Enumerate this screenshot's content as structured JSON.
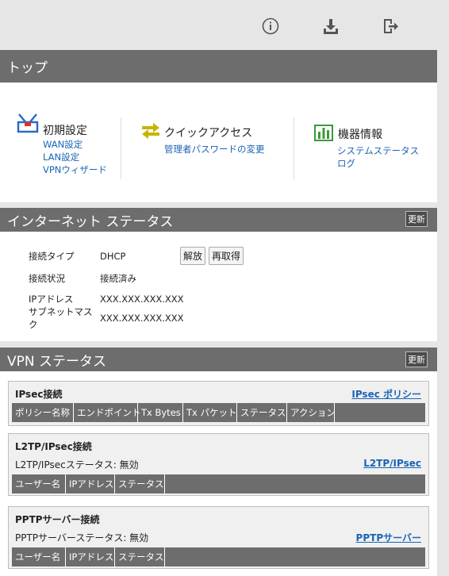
{
  "toolbar": {
    "icons": [
      "info-icon",
      "download-icon",
      "logout-icon"
    ]
  },
  "top": {
    "title": "トップ",
    "menus": [
      {
        "title": "初期設定",
        "icon": "toolbox-icon",
        "links": [
          "WAN設定",
          "LAN設定",
          "VPNウィザード"
        ]
      },
      {
        "title": "クイックアクセス",
        "icon": "swap-arrows-icon",
        "links": [
          "管理者パスワードの変更"
        ]
      },
      {
        "title": "機器情報",
        "icon": "bar-chart-icon",
        "links": [
          "システムステータス",
          "ログ"
        ]
      }
    ]
  },
  "internet": {
    "title": "インターネット ステータス",
    "refresh": "更新",
    "rows": [
      {
        "label": "接続タイプ",
        "value": "DHCP"
      },
      {
        "label": "接続状況",
        "value": "接続済み"
      },
      {
        "label": "IPアドレス",
        "value": "XXX.XXX.XXX.XXX"
      },
      {
        "label": "サブネットマスク",
        "value": "XXX.XXX.XXX.XXX"
      }
    ],
    "release_label": "解放",
    "renew_label": "再取得"
  },
  "vpn": {
    "title": "VPN ステータス",
    "refresh": "更新",
    "ipsec": {
      "title": "IPsec接続",
      "link": "IPsec ポリシー",
      "columns": [
        "ポリシー名称",
        "エンドポイント",
        "Tx Bytes",
        "Tx パケット",
        "ステータス",
        "アクション"
      ]
    },
    "l2tp": {
      "title": "L2TP/IPsec接続",
      "status": "L2TP/IPsecステータス: 無効",
      "link": "L2TP/IPsec",
      "columns": [
        "ユーザー名",
        "IPアドレス",
        "ステータス"
      ]
    },
    "pptp": {
      "title": "PPTPサーバー接続",
      "status": "PPTPサーバーステータス: 無効",
      "link": "PPTPサーバー",
      "columns": [
        "ユーザー名",
        "IPアドレス",
        "ステータス"
      ]
    }
  },
  "colors": {
    "header_bar": "#6d6d6d",
    "link": "#1a64b6",
    "accent_icon": "#2b6cc4",
    "green": "#3a9a3a",
    "arrow": "#c8b400"
  }
}
